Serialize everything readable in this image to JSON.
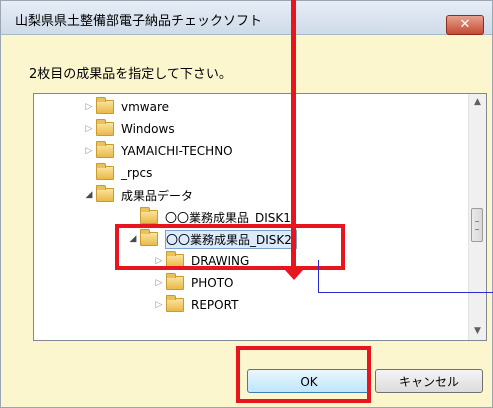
{
  "window": {
    "title": "山梨県県土整備部電子納品チェックソフト",
    "close_label": "✕"
  },
  "prompt": "2枚目の成果品を指定して下さい。",
  "tree": {
    "items": [
      {
        "label": "vmware",
        "expander": "▷"
      },
      {
        "label": "Windows",
        "expander": "▷"
      },
      {
        "label": "YAMAICHI-TECHNO",
        "expander": "▷"
      },
      {
        "label": "_rpcs",
        "expander": ""
      },
      {
        "label": "成果品データ",
        "expander": "◢"
      },
      {
        "label": "〇〇業務成果品_DISK1",
        "expander": ""
      },
      {
        "label": "〇〇業務成果品_DISK2",
        "expander": "◢"
      },
      {
        "label": "DRAWING",
        "expander": "▷"
      },
      {
        "label": "PHOTO",
        "expander": "▷"
      },
      {
        "label": "REPORT",
        "expander": "▷"
      }
    ],
    "selected_index": 6
  },
  "buttons": {
    "ok": "OK",
    "cancel": "キャンセル"
  },
  "colors": {
    "annotation_red": "#e8141e",
    "annotation_blue": "#2a2ad6",
    "background": "#fcf6cf"
  }
}
